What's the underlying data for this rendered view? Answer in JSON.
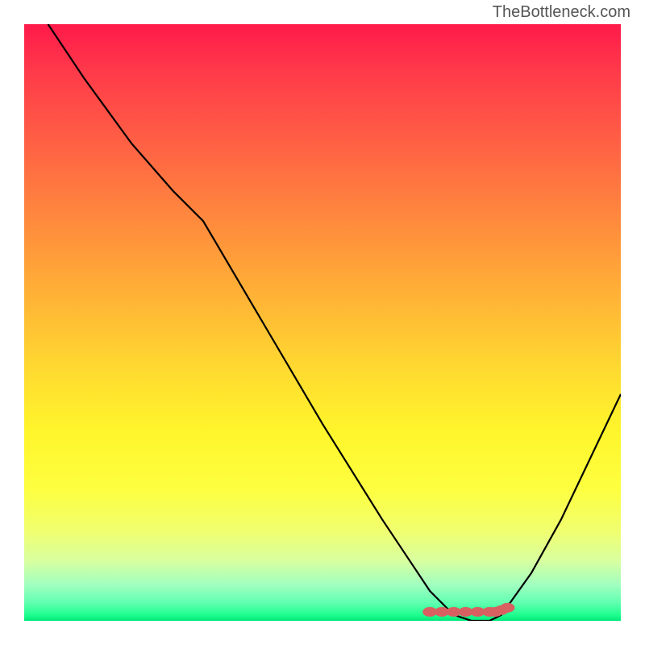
{
  "watermark": "TheBottleneck.com",
  "chart_data": {
    "type": "line",
    "title": "",
    "xlabel": "",
    "ylabel": "",
    "xlim": [
      0,
      100
    ],
    "ylim": [
      0,
      100
    ],
    "gradient_colors": {
      "top": "#ff1a4a",
      "middle": "#ffda30",
      "bottom": "#00e878"
    },
    "series": [
      {
        "name": "bottleneck-curve",
        "x": [
          4,
          10,
          18,
          25,
          30,
          40,
          50,
          60,
          68,
          72,
          75,
          78,
          80,
          85,
          90,
          100
        ],
        "y": [
          100,
          91,
          80,
          72,
          67,
          50,
          33,
          17,
          5,
          1,
          0,
          0,
          1,
          8,
          17,
          38
        ]
      }
    ],
    "marker_region": {
      "name": "optimal-range",
      "color": "#d86060",
      "points_x": [
        68,
        70,
        72,
        74,
        76,
        78,
        79,
        80,
        81
      ],
      "points_y": [
        1.5,
        1.5,
        1.5,
        1.5,
        1.5,
        1.5,
        1.5,
        1.8,
        2.2
      ]
    }
  }
}
